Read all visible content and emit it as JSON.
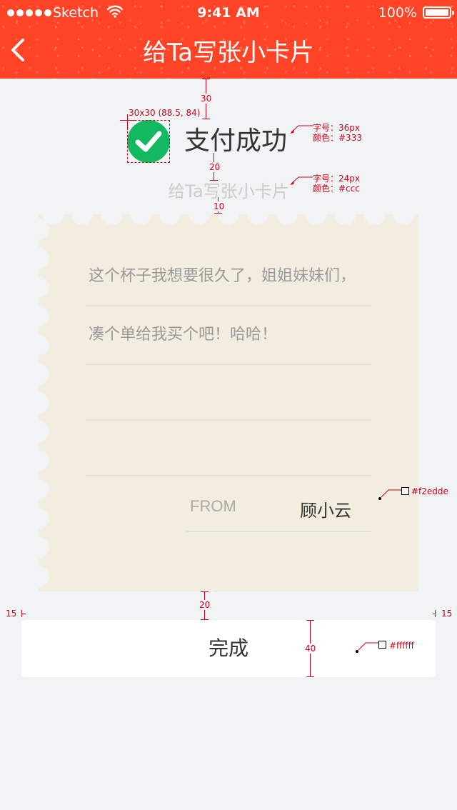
{
  "status_bar": {
    "carrier": "Sketch",
    "time": "9:41 AM",
    "battery": "100%"
  },
  "nav": {
    "title": "给Ta写张小卡片",
    "back_icon": "chevron-left-icon"
  },
  "success": {
    "icon": "check-circle-icon",
    "icon_color": "#12b960",
    "text": "支付成功",
    "subtitle": "给Ta写张小卡片"
  },
  "card": {
    "background": "#f2edde",
    "message_lines": [
      "这个杯子我想要很久了，姐姐妹妹们，",
      "凑个单给我买个吧！哈哈！",
      "",
      ""
    ],
    "from_label": "FROM",
    "from_name": "顾小云"
  },
  "done_button": {
    "label": "完成",
    "background": "#ffffff"
  },
  "annotations": {
    "gap_top": "30",
    "icon_spec": "30x30 (88.5, 84)",
    "title_font_size": "字号：36px",
    "title_color": "颜色：#333",
    "gap_title_subtitle": "20",
    "subtitle_font_size": "字号：24px",
    "subtitle_color": "颜色：#ccc",
    "gap_subtitle_card": "10",
    "card_color": "#f2edde",
    "gap_card_button": "20",
    "margin_left": "15",
    "margin_right": "15",
    "button_height": "40",
    "button_color": "#ffffff"
  },
  "colors": {
    "header": "#ff4326",
    "page_background": "#f2f3f5",
    "annotation": "#d0021b"
  }
}
